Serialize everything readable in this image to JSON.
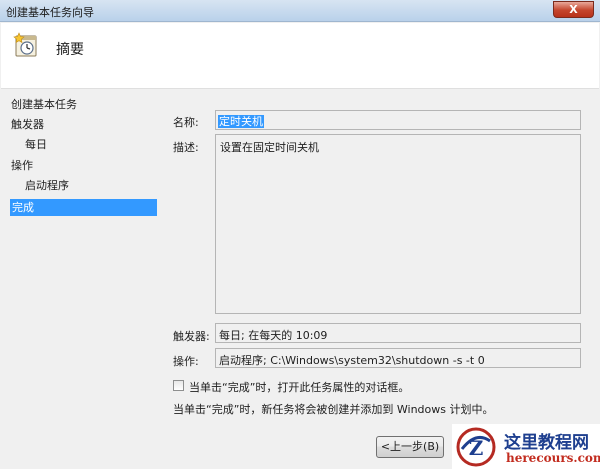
{
  "window": {
    "title": "创建基本任务向导",
    "close_label": "X"
  },
  "header": {
    "heading": "摘要",
    "icon": "task-clock-icon"
  },
  "sidebar": {
    "items": [
      {
        "label": "创建基本任务",
        "selected": false
      },
      {
        "label": "触发器",
        "selected": false
      },
      {
        "label": "每日",
        "selected": false
      },
      {
        "label": "操作",
        "selected": false
      },
      {
        "label": "启动程序",
        "selected": false
      },
      {
        "label": "完成",
        "selected": true
      }
    ]
  },
  "summary": {
    "name_label": "名称:",
    "name_value": "定时关机",
    "description_label": "描述:",
    "description_value": "设置在固定时间关机",
    "trigger_label": "触发器:",
    "trigger_value": "每日; 在每天的 10:09",
    "action_label": "操作:",
    "action_value": "启动程序; C:\\Windows\\system32\\shutdown -s -t 0"
  },
  "options": {
    "open_properties_label": "当单击“完成”时，打开此任务属性的对话框。",
    "open_properties_checked": false,
    "info_text": "当单击“完成”时，新任务将会被创建并添加到 Windows 计划中。"
  },
  "buttons": {
    "back_label": "<上一步(B)"
  },
  "watermark": {
    "title": "这里教程网",
    "subtitle": "herecours.com",
    "logo_letter": "Z"
  }
}
